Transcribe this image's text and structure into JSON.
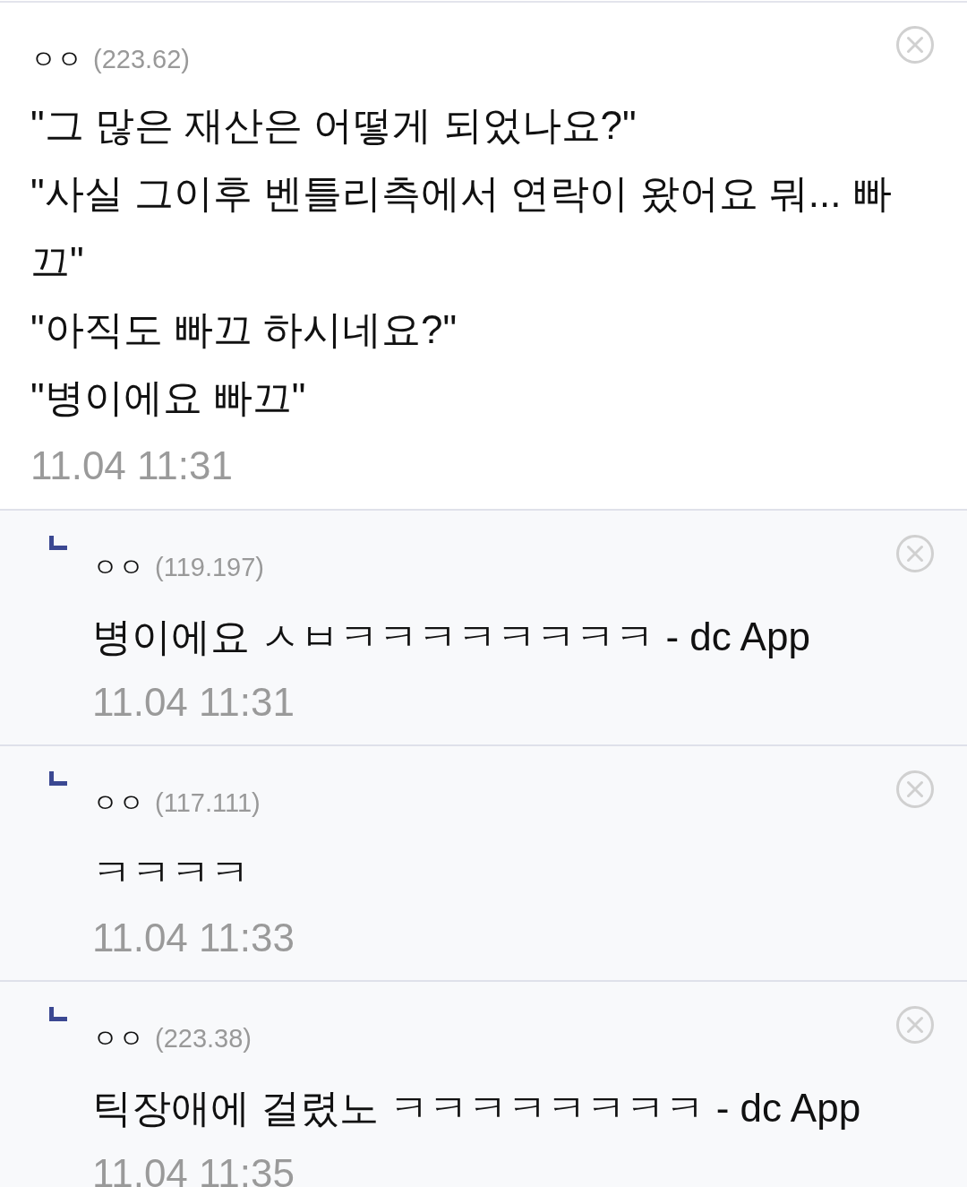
{
  "comment": {
    "nickname": "ㅇㅇ",
    "ip": "(223.62)",
    "lines": [
      "\"그 많은 재산은 어떻게 되었나요?\"",
      "\"사실 그이후 벤틀리측에서 연락이 왔어요 뭐... 빠끄\"",
      "\"아직도 빠끄 하시네요?\"",
      "\"병이에요 빠끄\""
    ],
    "time": "11.04 11:31"
  },
  "replies": [
    {
      "nickname": "ㅇㅇ",
      "ip": "(119.197)",
      "text": "병이에요 ㅅㅂㅋㅋㅋㅋㅋㅋㅋㅋ - dc App",
      "time": "11.04 11:31"
    },
    {
      "nickname": "ㅇㅇ",
      "ip": "(117.111)",
      "text": "ㅋㅋㅋㅋ",
      "time": "11.04 11:33"
    },
    {
      "nickname": "ㅇㅇ",
      "ip": "(223.38)",
      "text": "틱장애에 걸렸노 ㅋㅋㅋㅋㅋㅋㅋㅋ - dc App",
      "time": "11.04 11:35"
    }
  ]
}
